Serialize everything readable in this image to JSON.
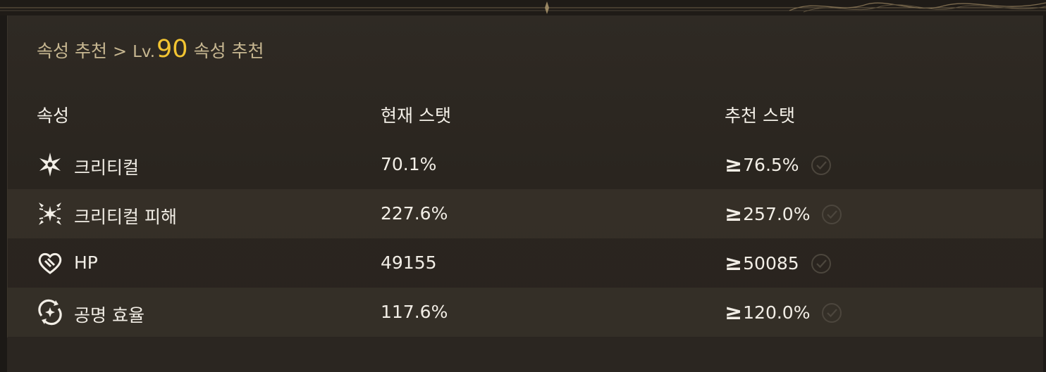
{
  "breadcrumb": {
    "part1": "속성 추천",
    "separator": ">",
    "lv_prefix": "Lv.",
    "lv_number": "90",
    "part2": "속성 추천"
  },
  "table": {
    "headers": {
      "attribute": "속성",
      "current": "현재 스탯",
      "recommended": "추천 스탯"
    },
    "rows": [
      {
        "icon": "crit-rate-icon",
        "name": "크리티컬",
        "current": "70.1%",
        "ge": "≥",
        "recommended": "76.5%"
      },
      {
        "icon": "crit-damage-icon",
        "name": "크리티컬 피해",
        "current": "227.6%",
        "ge": "≥",
        "recommended": "257.0%"
      },
      {
        "icon": "hp-heart-icon",
        "name": "HP",
        "current": "49155",
        "ge": "≥",
        "recommended": "50085"
      },
      {
        "icon": "energy-recharge-icon",
        "name": "공명 효율",
        "current": "117.6%",
        "ge": "≥",
        "recommended": "120.0%"
      }
    ]
  },
  "colors": {
    "accent_gold": "#f2c432",
    "breadcrumb_text": "#c7b791",
    "text": "#f2eee6"
  }
}
